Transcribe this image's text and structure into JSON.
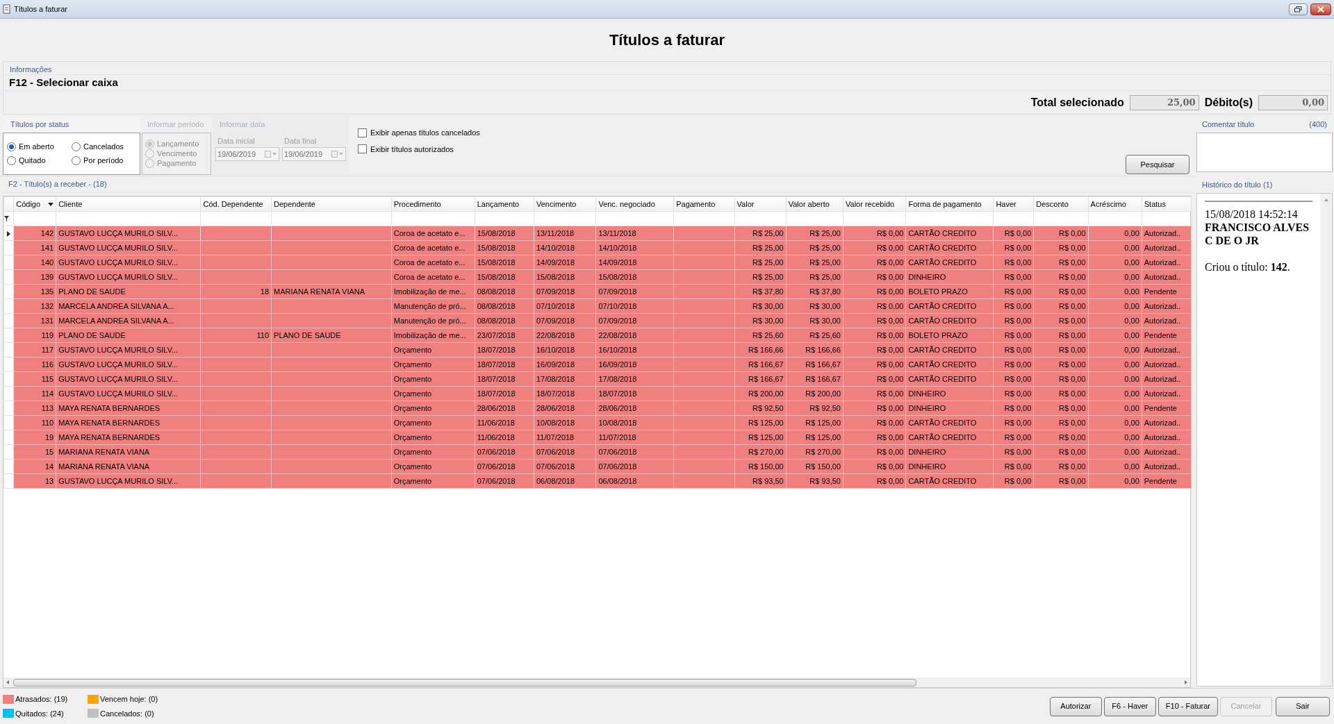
{
  "window": {
    "title": "Títulos a faturar"
  },
  "heading": "Títulos a faturar",
  "info": {
    "label": "Informações",
    "caixa": "F12 - Selecionar caixa",
    "total_label": "Total selecionado",
    "total_value": "25,00",
    "debito_label": "Débito(s)",
    "debito_value": "0,00"
  },
  "status_group": {
    "label": "Títulos por status",
    "options": [
      {
        "label": "Em aberto",
        "selected": true
      },
      {
        "label": "Cancelados",
        "selected": false
      },
      {
        "label": "Quitado",
        "selected": false
      },
      {
        "label": "Por período",
        "selected": false
      }
    ]
  },
  "period_group": {
    "label": "Informar período",
    "disabled": true,
    "options": [
      {
        "label": "Lançamento",
        "selected": true
      },
      {
        "label": "Vencimento",
        "selected": false
      },
      {
        "label": "Pagamento",
        "selected": false
      }
    ]
  },
  "date_group": {
    "label": "Informar data",
    "disabled": true,
    "fields": [
      {
        "label": "Data inicial",
        "value": "19/06/2019"
      },
      {
        "label": "Data final",
        "value": "19/06/2019"
      }
    ]
  },
  "checkboxes": [
    {
      "label": "Exibir apenas títulos cancelados",
      "checked": false
    },
    {
      "label": "Exibir títulos autorizados",
      "checked": false
    }
  ],
  "search_button": "Pesquisar",
  "table": {
    "label": "F2 - Título(s) a receber - (18)",
    "columns": [
      {
        "label": "Código",
        "sorted": true
      },
      {
        "label": "Cliente",
        "sorted": false
      },
      {
        "label": "Cód. Dependente",
        "sorted": false
      },
      {
        "label": "Dependente",
        "sorted": false
      },
      {
        "label": "Procedimento",
        "sorted": false
      },
      {
        "label": "Lançamento",
        "sorted": false
      },
      {
        "label": "Vencimento",
        "sorted": false
      },
      {
        "label": "Venc. negociado",
        "sorted": false
      },
      {
        "label": "Pagamento",
        "sorted": false
      },
      {
        "label": "Valor",
        "sorted": false
      },
      {
        "label": "Valor aberto",
        "sorted": false
      },
      {
        "label": "Valor recebido",
        "sorted": false
      },
      {
        "label": "Forma de pagamento",
        "sorted": false
      },
      {
        "label": "Haver",
        "sorted": false
      },
      {
        "label": "Desconto",
        "sorted": false
      },
      {
        "label": "Acréscimo",
        "sorted": false
      },
      {
        "label": "Status",
        "sorted": false
      }
    ],
    "rows": [
      {
        "selected": true,
        "cells": [
          "142",
          "GUSTAVO LUCÇA MURILO SILV...",
          null,
          null,
          "Coroa de acetato e...",
          "15/08/2018",
          "13/11/2018",
          "13/11/2018",
          null,
          "R$ 25,00",
          "R$ 25,00",
          "R$ 0,00",
          "CARTÃO CREDITO",
          "R$ 0,00",
          "R$ 0,00",
          "0,00",
          "Autorizad.."
        ]
      },
      {
        "selected": false,
        "cells": [
          "141",
          "GUSTAVO LUCÇA MURILO SILV...",
          null,
          null,
          "Coroa de acetato e...",
          "15/08/2018",
          "14/10/2018",
          "14/10/2018",
          null,
          "R$ 25,00",
          "R$ 25,00",
          "R$ 0,00",
          "CARTÃO CREDITO",
          "R$ 0,00",
          "R$ 0,00",
          "0,00",
          "Autorizad.."
        ]
      },
      {
        "selected": false,
        "cells": [
          "140",
          "GUSTAVO LUCÇA MURILO SILV...",
          null,
          null,
          "Coroa de acetato e...",
          "15/08/2018",
          "14/09/2018",
          "14/09/2018",
          null,
          "R$ 25,00",
          "R$ 25,00",
          "R$ 0,00",
          "CARTÃO CREDITO",
          "R$ 0,00",
          "R$ 0,00",
          "0,00",
          "Autorizad.."
        ]
      },
      {
        "selected": false,
        "cells": [
          "139",
          "GUSTAVO LUCÇA MURILO SILV...",
          null,
          null,
          "Coroa de acetato e...",
          "15/08/2018",
          "15/08/2018",
          "15/08/2018",
          null,
          "R$ 25,00",
          "R$ 25,00",
          "R$ 0,00",
          "DINHEIRO",
          "R$ 0,00",
          "R$ 0,00",
          "0,00",
          "Autorizad.."
        ]
      },
      {
        "selected": false,
        "cells": [
          "135",
          "PLANO DE SAUDE",
          "18",
          "MARIANA RENATA VIANA",
          "Imobilização de me...",
          "08/08/2018",
          "07/09/2018",
          "07/09/2018",
          null,
          "R$ 37,80",
          "R$ 37,80",
          "R$ 0,00",
          "BOLETO PRAZO",
          "R$ 0,00",
          "R$ 0,00",
          "0,00",
          "Pendente"
        ]
      },
      {
        "selected": false,
        "cells": [
          "132",
          "MARCELA ANDREA SILVANA A...",
          null,
          null,
          "Manutenção de pró...",
          "08/08/2018",
          "07/10/2018",
          "07/10/2018",
          null,
          "R$ 30,00",
          "R$ 30,00",
          "R$ 0,00",
          "CARTÃO CREDITO",
          "R$ 0,00",
          "R$ 0,00",
          "0,00",
          "Autorizad.."
        ]
      },
      {
        "selected": false,
        "cells": [
          "131",
          "MARCELA ANDREA SILVANA A...",
          null,
          null,
          "Manutenção de pró...",
          "08/08/2018",
          "07/09/2018",
          "07/09/2018",
          null,
          "R$ 30,00",
          "R$ 30,00",
          "R$ 0,00",
          "CARTÃO CREDITO",
          "R$ 0,00",
          "R$ 0,00",
          "0,00",
          "Autorizad.."
        ]
      },
      {
        "selected": false,
        "cells": [
          "119",
          "PLANO DE SAUDE",
          "110",
          "PLANO DE SAUDE",
          "Imobilização de me...",
          "23/07/2018",
          "22/08/2018",
          "22/08/2018",
          null,
          "R$ 25,60",
          "R$ 25,60",
          "R$ 0,00",
          "BOLETO PRAZO",
          "R$ 0,00",
          "R$ 0,00",
          "0,00",
          "Pendente"
        ]
      },
      {
        "selected": false,
        "cells": [
          "117",
          "GUSTAVO LUCÇA MURILO SILV...",
          null,
          null,
          "Orçamento",
          "18/07/2018",
          "16/10/2018",
          "16/10/2018",
          null,
          "R$ 166,66",
          "R$ 166,66",
          "R$ 0,00",
          "CARTÃO CREDITO",
          "R$ 0,00",
          "R$ 0,00",
          "0,00",
          "Autorizad.."
        ]
      },
      {
        "selected": false,
        "cells": [
          "116",
          "GUSTAVO LUCÇA MURILO SILV...",
          null,
          null,
          "Orçamento",
          "18/07/2018",
          "16/09/2018",
          "16/09/2018",
          null,
          "R$ 166,67",
          "R$ 166,67",
          "R$ 0,00",
          "CARTÃO CREDITO",
          "R$ 0,00",
          "R$ 0,00",
          "0,00",
          "Autorizad.."
        ]
      },
      {
        "selected": false,
        "cells": [
          "115",
          "GUSTAVO LUCÇA MURILO SILV...",
          null,
          null,
          "Orçamento",
          "18/07/2018",
          "17/08/2018",
          "17/08/2018",
          null,
          "R$ 166,67",
          "R$ 166,67",
          "R$ 0,00",
          "CARTÃO CREDITO",
          "R$ 0,00",
          "R$ 0,00",
          "0,00",
          "Autorizad.."
        ]
      },
      {
        "selected": false,
        "cells": [
          "114",
          "GUSTAVO LUCÇA MURILO SILV...",
          null,
          null,
          "Orçamento",
          "18/07/2018",
          "18/07/2018",
          "18/07/2018",
          null,
          "R$ 200,00",
          "R$ 200,00",
          "R$ 0,00",
          "DINHEIRO",
          "R$ 0,00",
          "R$ 0,00",
          "0,00",
          "Autorizad.."
        ]
      },
      {
        "selected": false,
        "cells": [
          "113",
          "MAYA RENATA BERNARDES",
          null,
          null,
          "Orçamento",
          "28/06/2018",
          "28/06/2018",
          "28/06/2018",
          null,
          "R$ 92,50",
          "R$ 92,50",
          "R$ 0,00",
          "DINHEIRO",
          "R$ 0,00",
          "R$ 0,00",
          "0,00",
          "Pendente"
        ]
      },
      {
        "selected": false,
        "cells": [
          "110",
          "MAYA RENATA BERNARDES",
          null,
          null,
          "Orçamento",
          "11/06/2018",
          "10/08/2018",
          "10/08/2018",
          null,
          "R$ 125,00",
          "R$ 125,00",
          "R$ 0,00",
          "CARTÃO CREDITO",
          "R$ 0,00",
          "R$ 0,00",
          "0,00",
          "Autorizad.."
        ]
      },
      {
        "selected": false,
        "cells": [
          "19",
          "MAYA RENATA BERNARDES",
          null,
          null,
          "Orçamento",
          "11/06/2018",
          "11/07/2018",
          "11/07/2018",
          null,
          "R$ 125,00",
          "R$ 125,00",
          "R$ 0,00",
          "CARTÃO CREDITO",
          "R$ 0,00",
          "R$ 0,00",
          "0,00",
          "Autorizad.."
        ]
      },
      {
        "selected": false,
        "cells": [
          "15",
          "MARIANA RENATA VIANA",
          null,
          null,
          "Orçamento",
          "07/06/2018",
          "07/06/2018",
          "07/06/2018",
          null,
          "R$ 270,00",
          "R$ 270,00",
          "R$ 0,00",
          "DINHEIRO",
          "R$ 0,00",
          "R$ 0,00",
          "0,00",
          "Autorizad.."
        ]
      },
      {
        "selected": false,
        "cells": [
          "14",
          "MARIANA RENATA VIANA",
          null,
          null,
          "Orçamento",
          "07/06/2018",
          "07/06/2018",
          "07/06/2018",
          null,
          "R$ 150,00",
          "R$ 150,00",
          "R$ 0,00",
          "DINHEIRO",
          "R$ 0,00",
          "R$ 0,00",
          "0,00",
          "Autorizad.."
        ]
      },
      {
        "selected": false,
        "cells": [
          "13",
          "GUSTAVO LUCÇA MURILO SILV...",
          null,
          null,
          "Orçamento",
          "07/06/2018",
          "06/08/2018",
          "06/08/2018",
          null,
          "R$ 93,50",
          "R$ 93,50",
          "R$ 0,00",
          "CARTÃO CREDITO",
          "R$ 0,00",
          "R$ 0,00",
          "0,00",
          "Pendente"
        ]
      }
    ]
  },
  "comment": {
    "label": "Comentar título",
    "count": "(400)"
  },
  "history": {
    "label": "Histórico do título (1)",
    "timestamp": "15/08/2018 14:52:14",
    "author": "FRANCISCO ALVES C DE O JR",
    "text": "Criou o título: **142**."
  },
  "legend": [
    {
      "label": "Atrasados: (19)",
      "color": "#f08080"
    },
    {
      "label": "Vencem hoje: (0)",
      "color": "#ffa500"
    },
    {
      "label": "Quitados: (24)",
      "color": "#00bfff"
    },
    {
      "label": "Cancelados: (0)",
      "color": "#c0c0c0"
    }
  ],
  "buttons": [
    {
      "label": "Autorizar",
      "disabled": false
    },
    {
      "label": "F6 - Haver",
      "disabled": false
    },
    {
      "label": "F10 - Faturar",
      "disabled": false
    },
    {
      "label": "Cancelar",
      "disabled": true
    },
    {
      "label": "Sair",
      "disabled": false
    }
  ]
}
